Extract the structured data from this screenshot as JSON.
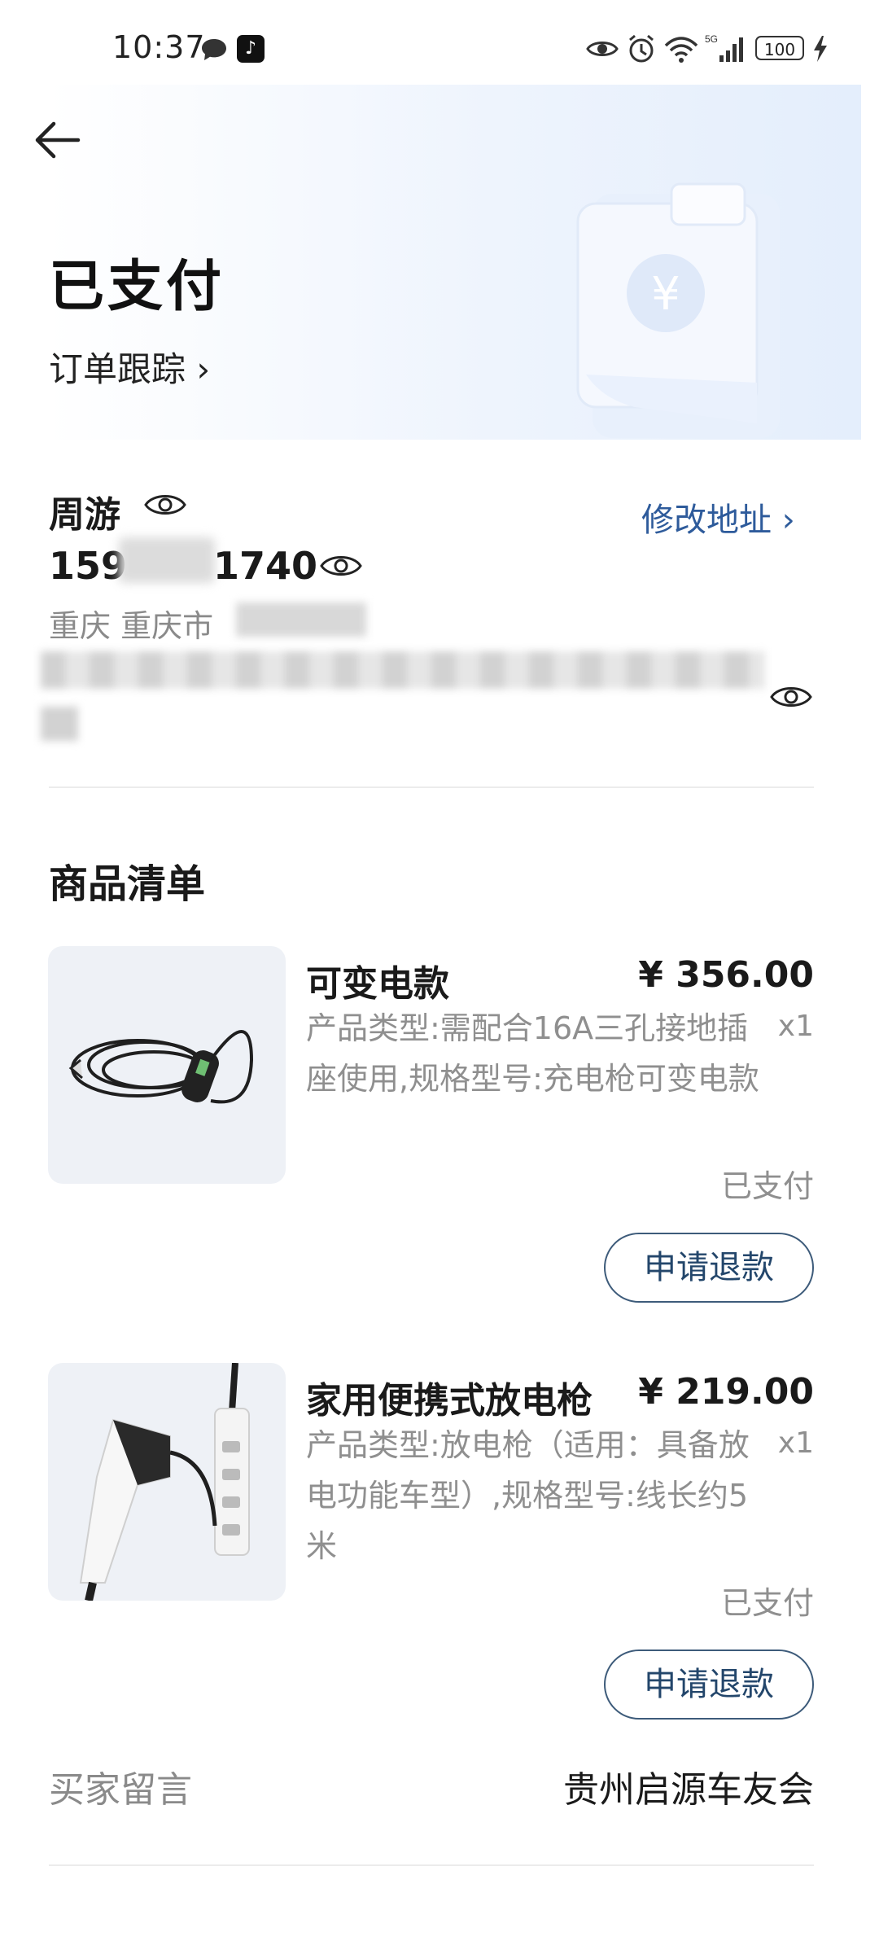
{
  "status_bar": {
    "time": "10:37",
    "battery": "100",
    "network": "5G",
    "icons": [
      "message-icon",
      "tiktok-icon",
      "eye-icon",
      "alarm-icon",
      "wifi-icon",
      "signal-icon",
      "battery-icon",
      "charging-icon"
    ]
  },
  "header": {
    "status_title": "已支付",
    "track_link": "订单跟踪 ›"
  },
  "address": {
    "name": "周游",
    "phone_prefix": "159",
    "phone_suffix": "1740",
    "edit_label": "修改地址 ›",
    "region": "重庆 重庆市"
  },
  "goods": {
    "section_title": "商品清单",
    "items": [
      {
        "title": "可变电款",
        "price": "¥ 356.00",
        "desc": "产品类型:需配合16A三孔接地插座使用,规格型号:充电枪可变电款",
        "qty": "x1",
        "status": "已支付",
        "refund_label": "申请退款"
      },
      {
        "title": "家用便携式放电枪",
        "price": "¥ 219.00",
        "desc": "产品类型:放电枪（适用：具备放电功能车型）,规格型号:线长约5米",
        "qty": "x1",
        "status": "已支付",
        "refund_label": "申请退款"
      }
    ]
  },
  "remark": {
    "label": "买家留言",
    "value": "贵州启源车友会"
  },
  "colors": {
    "link_blue": "#2e5b9b",
    "refund_border": "#3d5b7a",
    "muted_text": "#8f8f8f"
  }
}
